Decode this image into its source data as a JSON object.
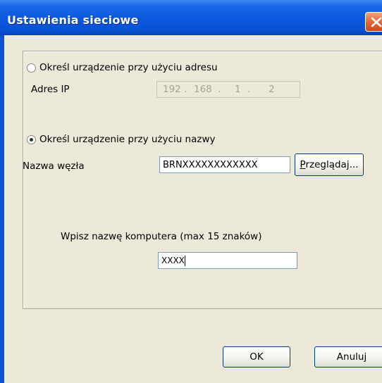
{
  "window": {
    "title": "Ustawienia sieciowe"
  },
  "by_address": {
    "radio_label": "Określ urządzenie przy użyciu adresu",
    "ip_label": "Adres IP",
    "ip": [
      "192",
      "168",
      "1",
      "2"
    ],
    "selected": false
  },
  "by_name": {
    "radio_label": "Określ urządzenie przy użyciu nazwy",
    "node_label": "Nazwa węzła",
    "node_value": "BRNXXXXXXXXXXXX",
    "browse_label": "Przeglądaj...",
    "selected": true
  },
  "computer": {
    "prompt": "Wpisz nazwę komputera (max 15 znaków)",
    "value": "XXXX"
  },
  "buttons": {
    "ok": "OK",
    "cancel": "Anuluj"
  },
  "icons": {
    "close": "close-icon"
  },
  "colors": {
    "title_bar": "#0a52d8",
    "close_button": "#d2461c",
    "dialog_bg": "#ece9d8"
  }
}
